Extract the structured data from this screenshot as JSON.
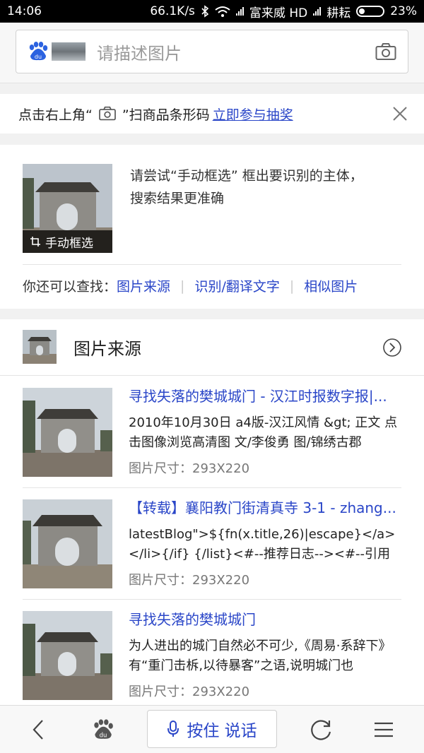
{
  "status_bar": {
    "time": "14:06",
    "speed": "66.1K/s",
    "carrier1": "富来威 HD",
    "carrier2": "耕耘",
    "battery": "23%"
  },
  "search": {
    "placeholder": "请描述图片",
    "logo_icon": "baidu-paw-icon",
    "camera_icon": "camera-icon"
  },
  "promo": {
    "prefix": "点击右上角“",
    "suffix": "”扫商品条形码",
    "link": "立即参与抽奖"
  },
  "tip": {
    "text_line1": "请尝试“手动框选” 框出要识别的主体，",
    "text_line2": "搜索结果更准确",
    "image_caption": "手动框选",
    "find_label": "你还可以查找：",
    "find_links": [
      "图片来源",
      "识别/翻译文字",
      "相似图片"
    ]
  },
  "results": {
    "header": "图片来源",
    "items": [
      {
        "title": "寻找失落的樊城城门 - 汉江时报数字报|...",
        "desc": "2010年10月30日 a4版-汉江风情 &gt; 正文 点击图像浏览高清图 文/李俊勇 图/锦绣古郡",
        "size": "图片尺寸：293X220"
      },
      {
        "title": "【转载】襄阳教门街清真寺 3-1 - zhang...",
        "desc": "latestBlog\">${fn(x.title,26)|escape}</a></li>{/if} {/list}<#--推荐日志--><#--引用记录-->",
        "size": "图片尺寸：293X220"
      },
      {
        "title": "寻找失落的樊城城门",
        "desc": "为人进出的城门自然必不可少,《周易·系辞下》有“重门击柝,以待暴客”之语,说明城门也",
        "size": "图片尺寸：293X220"
      }
    ]
  },
  "bottom_bar": {
    "voice_label": "按住 说话"
  },
  "colors": {
    "link_blue": "#2a46c8",
    "status_bar_bg": "#000000"
  }
}
